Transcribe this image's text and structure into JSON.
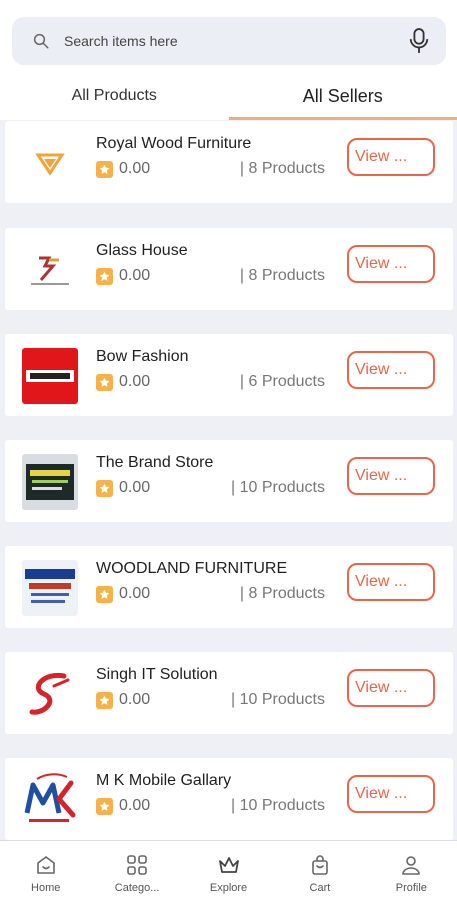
{
  "search": {
    "placeholder": "Search items here"
  },
  "tabs": [
    {
      "label": "All Products",
      "active": false
    },
    {
      "label": "All Sellers",
      "active": true
    }
  ],
  "sellers": [
    {
      "name": "Royal Wood Furniture",
      "rating": "0.00",
      "products": "| 8 Products",
      "view": "View ..."
    },
    {
      "name": "Glass House",
      "rating": "0.00",
      "products": "| 8 Products",
      "view": "View ..."
    },
    {
      "name": "Bow Fashion",
      "rating": "0.00",
      "products": "| 6 Products",
      "view": "View ..."
    },
    {
      "name": "The Brand Store",
      "rating": "0.00",
      "products": "| 10 Products",
      "view": "View ..."
    },
    {
      "name": "WOODLAND FURNITURE",
      "rating": "0.00",
      "products": "| 8 Products",
      "view": "View ..."
    },
    {
      "name": "Singh IT Solution",
      "rating": "0.00",
      "products": "| 10 Products",
      "view": "View ..."
    },
    {
      "name": "M K Mobile Gallary",
      "rating": "0.00",
      "products": "| 10 Products",
      "view": "View ..."
    }
  ],
  "nav": [
    {
      "label": "Home",
      "icon": "home-icon"
    },
    {
      "label": "Catego...",
      "icon": "categories-icon"
    },
    {
      "label": "Explore",
      "icon": "crown-icon"
    },
    {
      "label": "Cart",
      "icon": "cart-icon"
    },
    {
      "label": "Profile",
      "icon": "profile-icon"
    }
  ],
  "colors": {
    "accent": "#e8664a",
    "tab_underline": "#f3a98a",
    "star": "#f5b24a"
  }
}
